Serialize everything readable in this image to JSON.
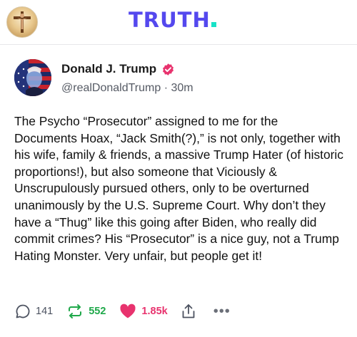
{
  "header": {
    "brand_name": "TRUTH",
    "brand_color": "#5448ee",
    "brand_dot_color": "#17e2c7",
    "avatar_icon": "user-avatar-icon"
  },
  "post": {
    "author": {
      "display_name": "Donald J. Trump",
      "handle": "@realDonaldTrump",
      "separator": "·",
      "time_ago": "30m",
      "verified_icon": "verified-badge-icon",
      "verified_color": "#e8336e"
    },
    "text": "The Psycho “Prosecutor” assigned to me for the Documents Hoax, “Jack Smith(?),” is not only, together with his wife, family & friends, a massive Trump Hater (of historic proportions!), but also someone that Viciously & Unscrupulously pursued others, only to be overturned unanimously by the U.S. Supreme Court. Why don’t they have a “Thug” like this going after Biden, who really did commit crimes? His “Prosecutor” is a nice guy, not a Trump Hating Monster. Very unfair, but people get it!",
    "actions": {
      "replies": "141",
      "reposts": "552",
      "likes": "1.85k",
      "reply_icon": "reply-bubble-icon",
      "repost_icon": "repost-icon",
      "like_icon": "heart-icon",
      "share_icon": "share-icon",
      "more_icon": "more-dots-icon",
      "more_label": "•••",
      "repost_color": "#1fa84a",
      "like_color": "#e8336e"
    }
  }
}
